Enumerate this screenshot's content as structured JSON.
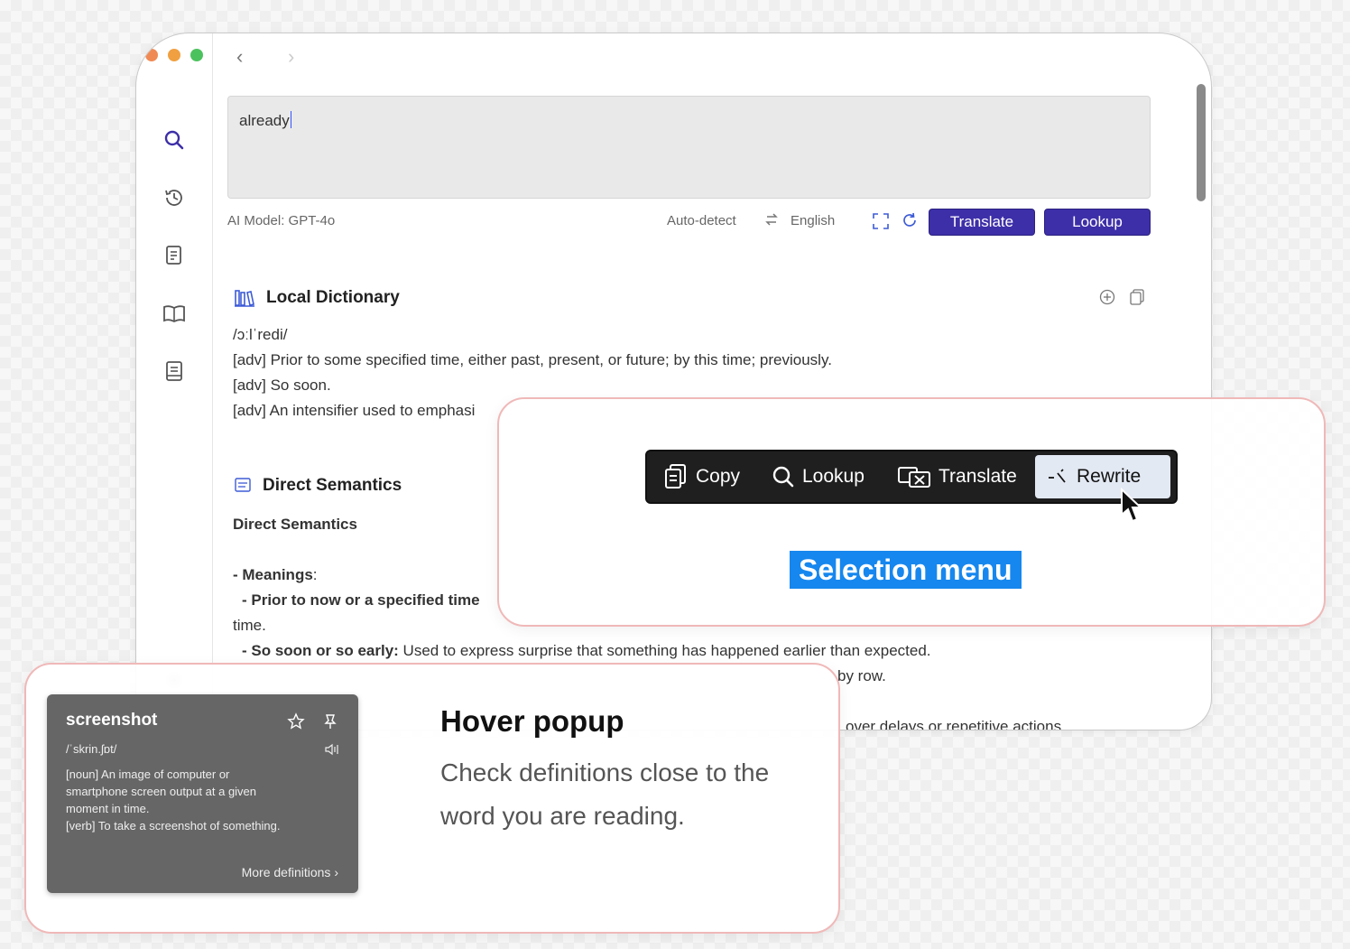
{
  "window": {
    "nav": {
      "back": "‹",
      "forward": "›"
    },
    "sidebar": {
      "items": [
        {
          "name": "search",
          "icon": "search-icon"
        },
        {
          "name": "history",
          "icon": "history-icon"
        },
        {
          "name": "notes",
          "icon": "notes-icon"
        },
        {
          "name": "dictionary",
          "icon": "book-icon"
        },
        {
          "name": "wordbook",
          "icon": "wordbook-icon"
        }
      ]
    },
    "input": {
      "value": "already"
    },
    "toolbar": {
      "model": "AI Model: GPT-4o",
      "source_lang": "Auto-detect",
      "target_lang": "English",
      "translate_label": "Translate",
      "lookup_label": "Lookup"
    },
    "local_dictionary": {
      "title": "Local Dictionary",
      "phonetic": "/ɔːlˈredi/",
      "definitions": [
        "[adv] Prior to some specified time, either past, present, or future; by this time; previously.",
        "[adv] So soon.",
        "[adv] An intensifier used to emphasi"
      ]
    },
    "direct_semantics": {
      "title": "Direct Semantics",
      "subtitle": "Direct Semantics",
      "meanings_label": "- Meanings",
      "meanings_colon": ":",
      "item1_bold": "- Prior to now or a specified time",
      "item1_cont": "time.",
      "item2_bold": "- So soon or so early:",
      "item2_text": " Used to express surprise that something has happened earlier than expected.",
      "fragment_row": "by row.",
      "fragment_actions": "over delays or repetitive actions."
    }
  },
  "selection_overlay": {
    "menu": {
      "copy": "Copy",
      "lookup": "Lookup",
      "translate": "Translate",
      "rewrite": "Rewrite"
    },
    "label": "Selection menu"
  },
  "hover_overlay": {
    "popup": {
      "word": "screenshot",
      "phonetic": "/ˈskrin.ʃɒt/",
      "def1": "[noun] An image of computer or smartphone screen output at a given moment in time.",
      "def2": "[verb] To take a screenshot of something.",
      "more": "More definitions"
    },
    "title": "Hover popup",
    "description": "Check definitions close to the word you are reading."
  },
  "colors": {
    "accent": "#3d2fa8",
    "label_blue": "#1687ee",
    "traffic": [
      "#f08a54",
      "#f0a040",
      "#4cc25e"
    ]
  }
}
